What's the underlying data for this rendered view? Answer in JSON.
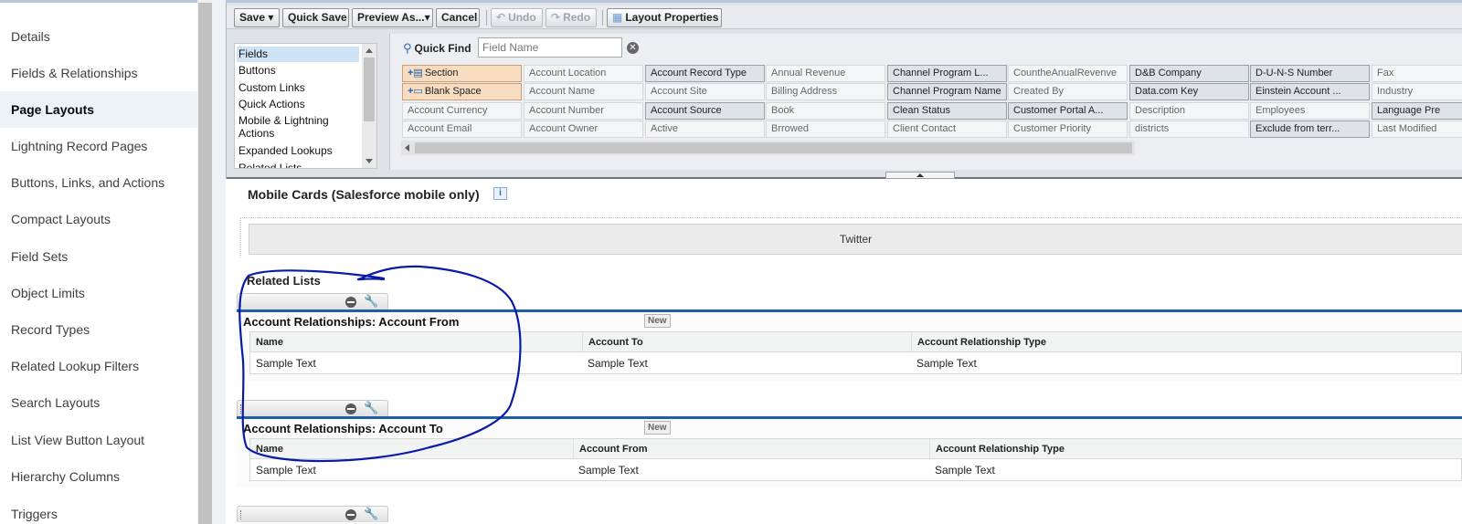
{
  "nav": {
    "items": [
      "Details",
      "Fields & Relationships",
      "Page Layouts",
      "Lightning Record Pages",
      "Buttons, Links, and Actions",
      "Compact Layouts",
      "Field Sets",
      "Object Limits",
      "Record Types",
      "Related Lookup Filters",
      "Search Layouts",
      "List View Button Layout",
      "Hierarchy Columns",
      "Triggers"
    ],
    "active": "Page Layouts"
  },
  "toolbar": {
    "save": "Save",
    "quick_save": "Quick Save",
    "preview_as": "Preview As...",
    "cancel": "Cancel",
    "undo": "Undo",
    "redo": "Redo",
    "layout_properties": "Layout Properties"
  },
  "palette": {
    "categories": [
      "Fields",
      "Buttons",
      "Custom Links",
      "Quick Actions",
      "Mobile & Lightning Actions",
      "Expanded Lookups",
      "Related Lists"
    ],
    "selected_category": "Fields",
    "quick_find_label": "Quick Find",
    "quick_find_placeholder": "Field Name",
    "fields": [
      [
        "Section",
        "Account Location",
        "Account Record Type",
        "Annual Revenue",
        "Channel Program L...",
        "CountheAnualRevenve",
        "D&B Company",
        "D-U-N-S Number",
        "Fax"
      ],
      [
        "Blank Space",
        "Account Name",
        "Account Site",
        "Billing Address",
        "Channel Program Name",
        "Created By",
        "Data.com Key",
        "Einstein Account ...",
        "Industry"
      ],
      [
        "Account Currency",
        "Account Number",
        "Account Source",
        "Book",
        "Clean Status",
        "Customer Portal A...",
        "Description",
        "Employees",
        "Language Pre"
      ],
      [
        "Account Email",
        "Account Owner",
        "Active",
        "Brrowed",
        "Client Contact",
        "Customer Priority",
        "districts",
        "Exclude from terr...",
        "Last Modified"
      ]
    ]
  },
  "canvas": {
    "mobile_cards_title": "Mobile Cards (Salesforce mobile only)",
    "info_glyph": "i",
    "twitter_card": "Twitter",
    "related_lists_title": "Related Lists",
    "related_lists": [
      {
        "name": "Account Relationships: Account From",
        "new_label": "New",
        "columns": [
          "Name",
          "Account To",
          "Account Relationship Type"
        ],
        "rows": [
          [
            "Sample Text",
            "Sample Text",
            "Sample Text"
          ]
        ]
      },
      {
        "name": "Account Relationships: Account To",
        "new_label": "New",
        "columns": [
          "Name",
          "Account From",
          "Account Relationship Type"
        ],
        "rows": [
          [
            "Sample Text",
            "Sample Text",
            "Sample Text"
          ]
        ]
      }
    ]
  },
  "colors": {
    "accent_blue": "#1f5fa8",
    "annotation_ink": "#0a1aa8",
    "special_field": "#f7dcc0",
    "active_nav_bg": "#edf2f8"
  }
}
